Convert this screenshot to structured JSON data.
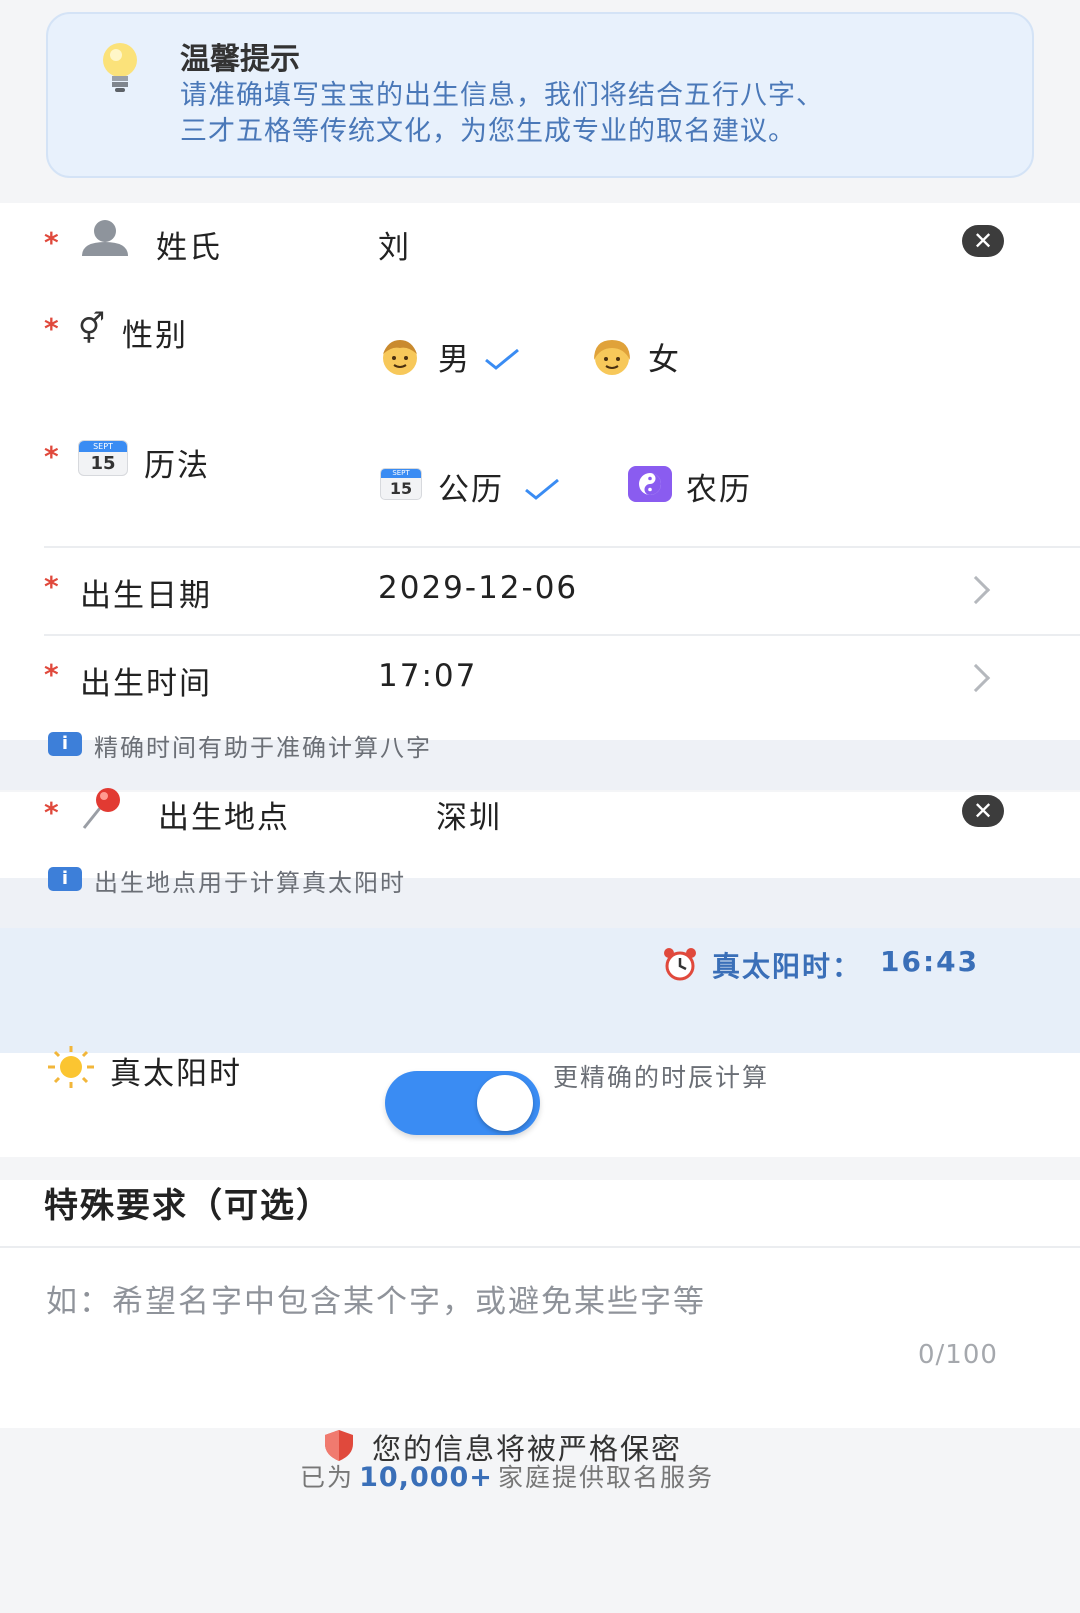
{
  "tip": {
    "title": "温馨提示",
    "line1": "请准确填写宝宝的出生信息，我们将结合五行八字、",
    "line2": "三才五格等传统文化，为您生成专业的取名建议。"
  },
  "form": {
    "required_mark": "*",
    "surname": {
      "label": "姓氏",
      "value": "刘",
      "clear": "✕"
    },
    "gender": {
      "label": "性别",
      "options": [
        {
          "label": "男",
          "selected": true
        },
        {
          "label": "女",
          "selected": false
        }
      ]
    },
    "calendar": {
      "label": "历法",
      "icon_day": "15",
      "icon_month": "SEPT",
      "options": [
        {
          "label": "公历",
          "selected": true
        },
        {
          "label": "农历",
          "selected": false
        }
      ]
    },
    "birth_date": {
      "label": "出生日期",
      "value": "2029-12-06"
    },
    "birth_time": {
      "label": "出生时间",
      "value": "17:07"
    },
    "time_hint": "精确时间有助于准确计算八字",
    "birth_place": {
      "label": "出生地点",
      "value": "深圳",
      "clear": "✕"
    },
    "place_hint": "出生地点用于计算真太阳时",
    "info_icon": "i"
  },
  "solar": {
    "computed_label": "真太阳时：",
    "computed_value": "16:43",
    "toggle_label": "真太阳时",
    "toggle_on": true,
    "toggle_desc": "更精确的时辰计算"
  },
  "special": {
    "title": "特殊要求（可选）",
    "placeholder": "如：希望名字中包含某个字，或避免某些字等",
    "counter": "0/100"
  },
  "footer": {
    "secure": "您的信息将被严格保密",
    "serve_prefix": "已为",
    "serve_count": "10,000+",
    "serve_suffix": "家庭提供取名服务"
  },
  "colors": {
    "accent": "#3a8cf3",
    "required": "#e0493c",
    "tip_bg": "#e8f1fc"
  }
}
